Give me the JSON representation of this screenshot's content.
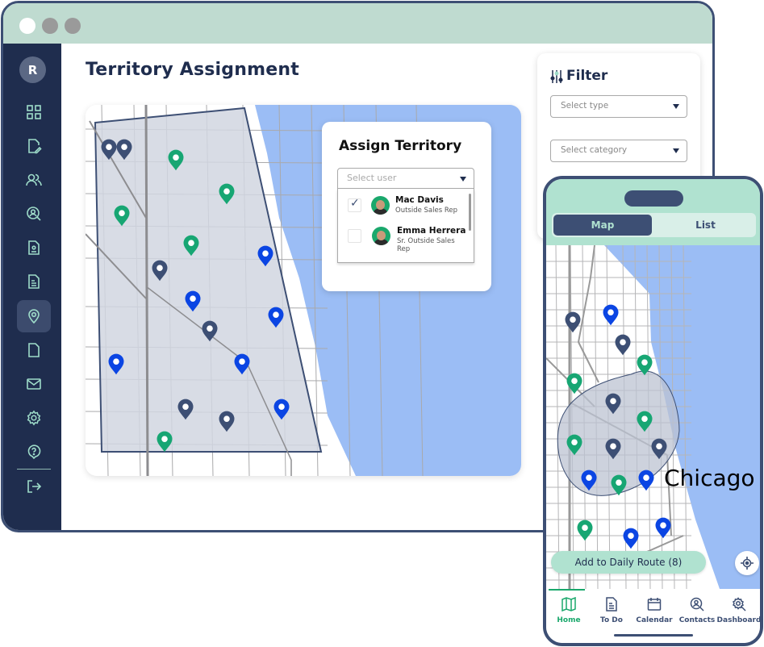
{
  "desktop": {
    "window_controls": [
      "close",
      "minimize",
      "maximize"
    ],
    "logo_letter": "R",
    "sidebar": {
      "items": [
        {
          "name": "dashboard",
          "icon": "grid-icon",
          "active": false
        },
        {
          "name": "edit-document",
          "icon": "edit-document-icon",
          "active": false
        },
        {
          "name": "users",
          "icon": "users-icon",
          "active": false
        },
        {
          "name": "search-contact",
          "icon": "search-user-icon",
          "active": false
        },
        {
          "name": "contact-card",
          "icon": "contact-card-icon",
          "active": false
        },
        {
          "name": "document-list",
          "icon": "document-lines-icon",
          "active": false
        },
        {
          "name": "territory",
          "icon": "location-pin-icon",
          "active": true
        },
        {
          "name": "file",
          "icon": "file-icon",
          "active": false
        },
        {
          "name": "mail",
          "icon": "mail-icon",
          "active": false
        },
        {
          "name": "settings",
          "icon": "gear-icon",
          "active": false
        },
        {
          "name": "help",
          "icon": "help-icon",
          "active": false
        }
      ],
      "logout_icon": "logout-icon"
    },
    "page_title": "Territory Assignment",
    "map": {
      "pins": [
        {
          "color": "navy"
        },
        {
          "color": "navy"
        },
        {
          "color": "green"
        },
        {
          "color": "green"
        },
        {
          "color": "green"
        },
        {
          "color": "green"
        },
        {
          "color": "blue"
        },
        {
          "color": "navy"
        },
        {
          "color": "blue"
        },
        {
          "color": "blue"
        },
        {
          "color": "navy"
        },
        {
          "color": "blue"
        },
        {
          "color": "blue"
        },
        {
          "color": "blue"
        },
        {
          "color": "navy"
        },
        {
          "color": "navy"
        },
        {
          "color": "green"
        }
      ]
    },
    "assign_panel": {
      "title": "Assign Territory",
      "select_placeholder": "Select user",
      "users": [
        {
          "name": "Mac Davis",
          "role": "Outside Sales Rep",
          "checked": true
        },
        {
          "name": "Emma Herrera",
          "role": "Sr. Outside Sales Rep",
          "checked": false
        }
      ]
    },
    "filter": {
      "title": "Filter",
      "type_placeholder": "Select type",
      "category_placeholder": "Select category"
    }
  },
  "mobile": {
    "segments": [
      {
        "label": "Map",
        "active": true
      },
      {
        "label": "List",
        "active": false
      }
    ],
    "map_label": "Chicago",
    "route_button": "Add to Daily Route (8)",
    "tabs": [
      {
        "label": "Home",
        "icon": "map-icon",
        "active": true
      },
      {
        "label": "To Do",
        "icon": "document-lines-icon",
        "active": false
      },
      {
        "label": "Calendar",
        "icon": "calendar-icon",
        "active": false
      },
      {
        "label": "Contacts",
        "icon": "search-user-icon",
        "active": false
      },
      {
        "label": "Dashboard",
        "icon": "dashboard-gear-icon",
        "active": false
      }
    ]
  },
  "colors": {
    "navy": "#1f2d4e",
    "frame": "#3d4f74",
    "mint": "#b0e2d0",
    "pin_green": "#1aa86c",
    "pin_blue": "#0d46e0",
    "pin_navy": "#3d4f74",
    "water": "#9bbdf5"
  },
  "pin_legend": {
    "navy": "#3d4f74",
    "green": "#17a673",
    "blue": "#0b45e3"
  }
}
